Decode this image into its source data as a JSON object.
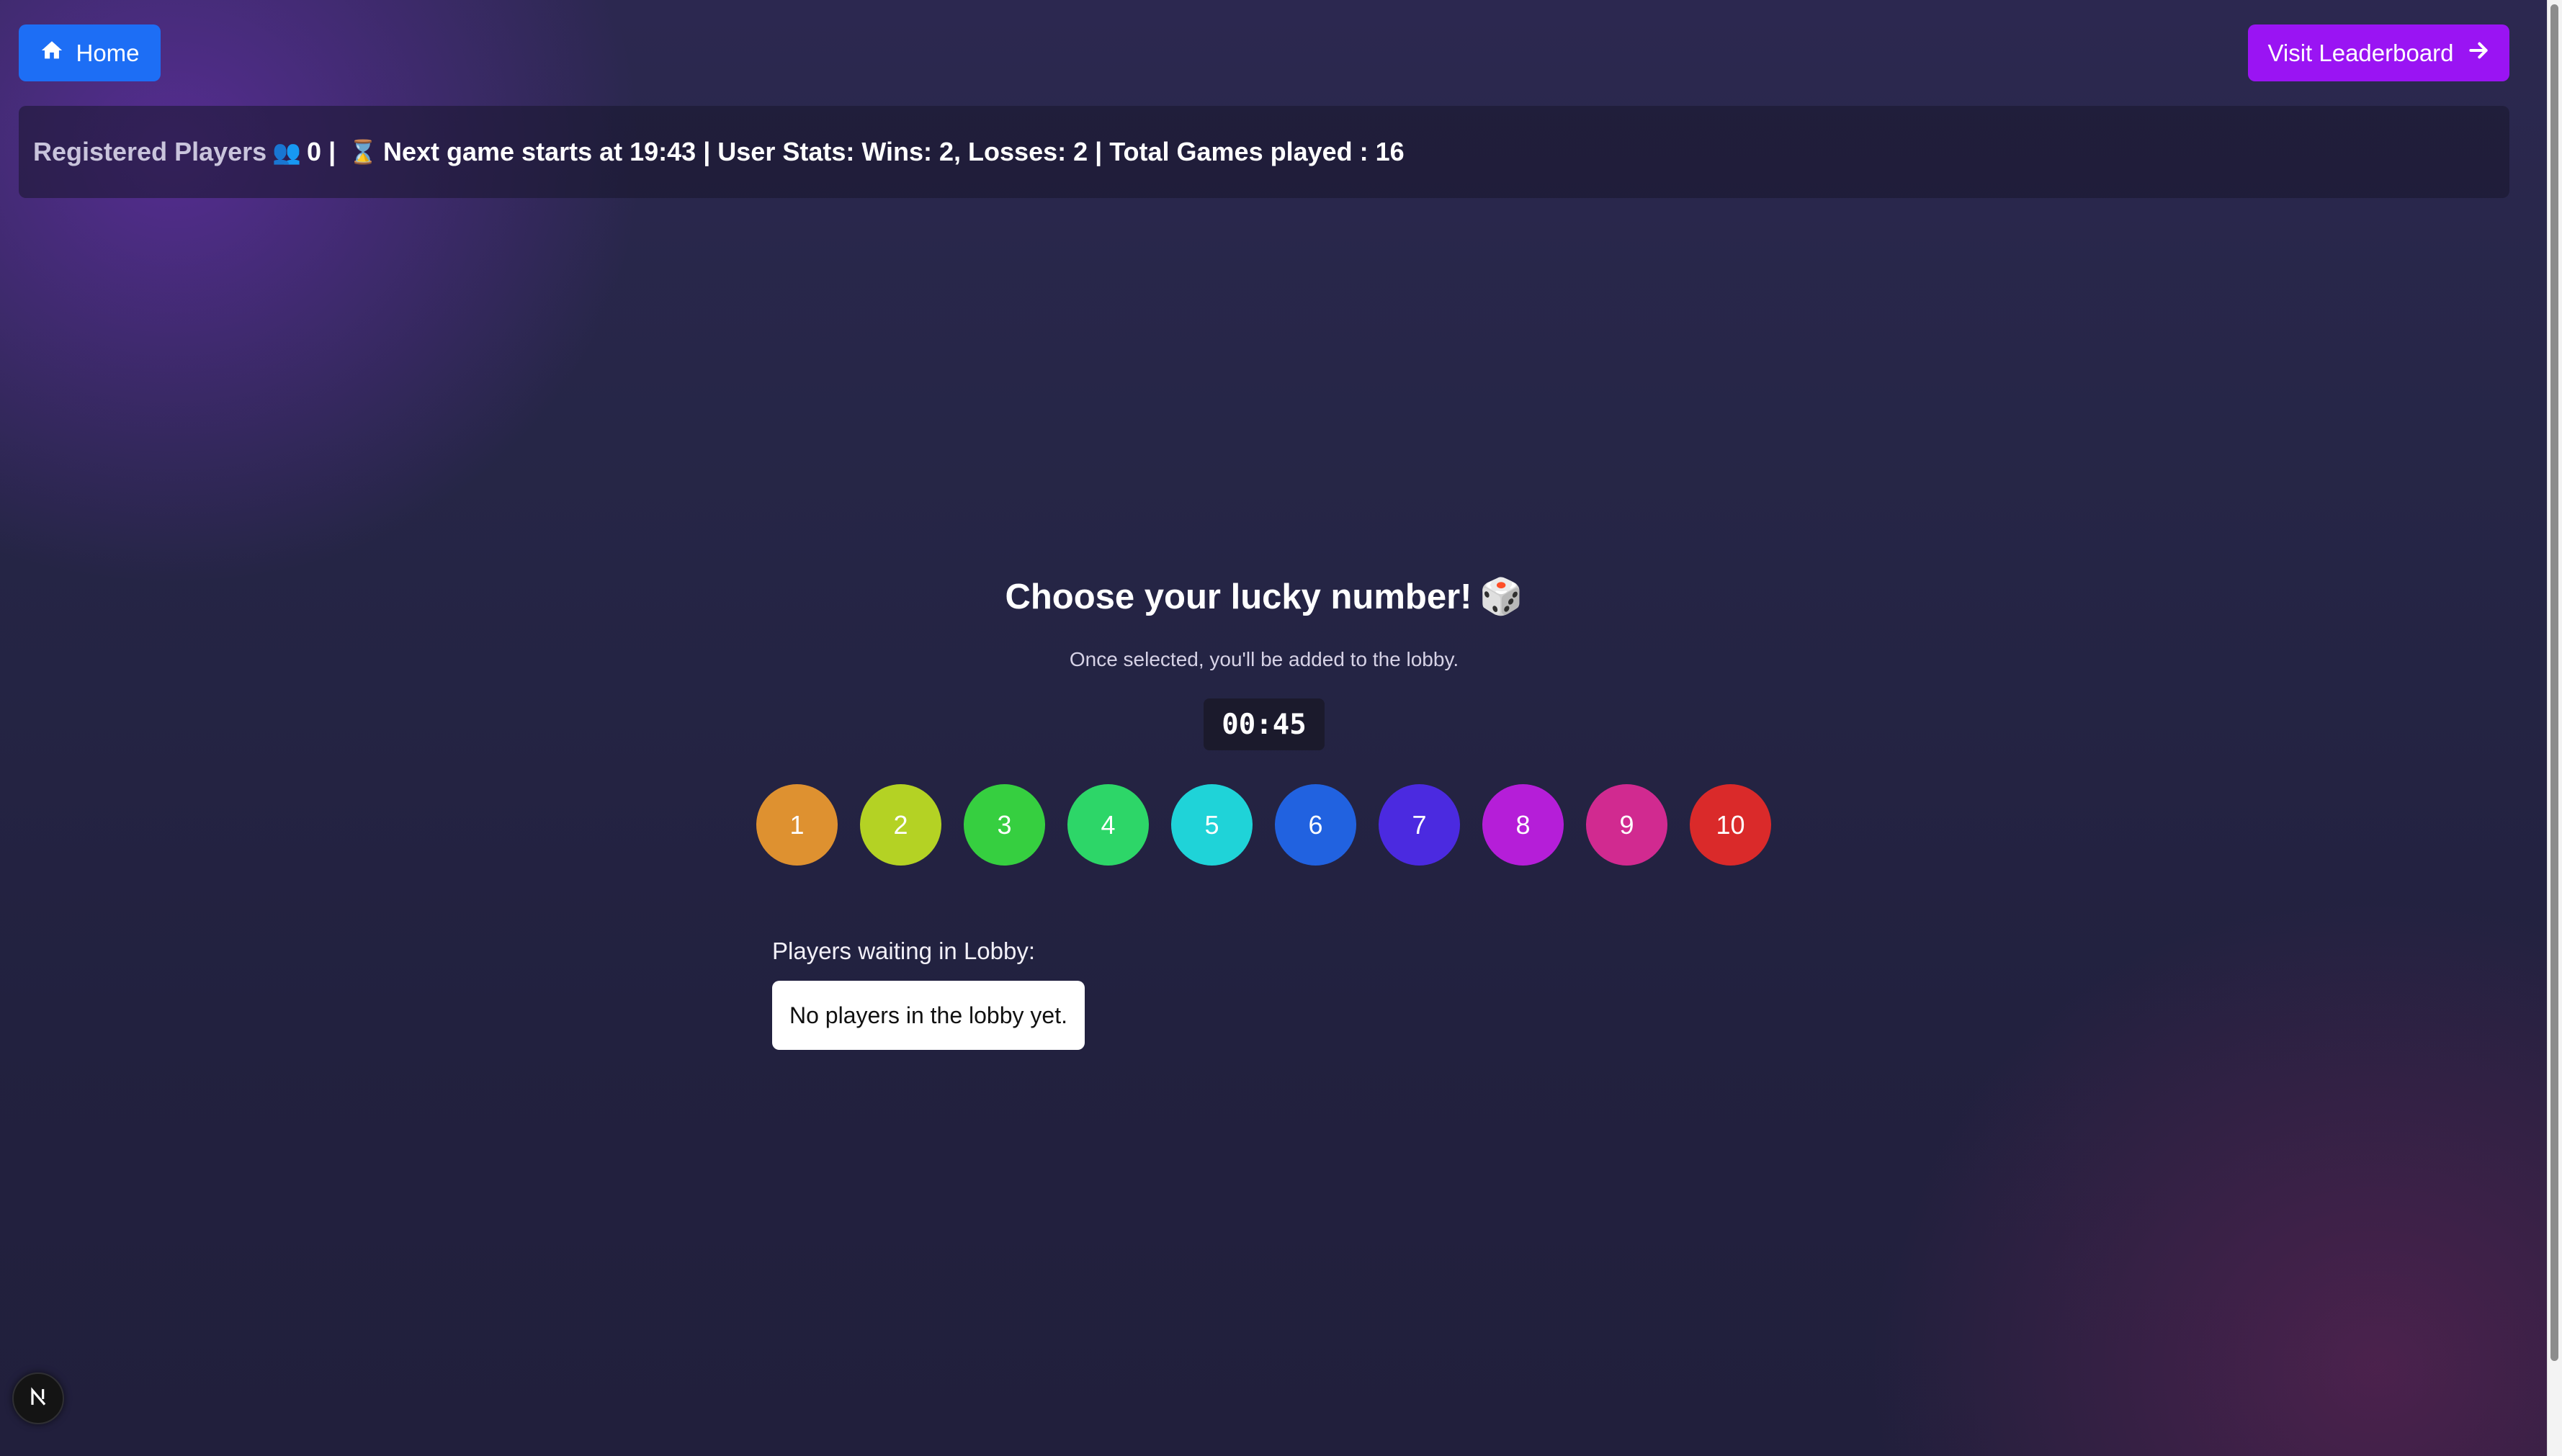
{
  "header": {
    "home_label": "Home",
    "leaderboard_label": "Visit Leaderboard",
    "home_icon": "house-icon",
    "leaderboard_icon": "arrow-right-icon"
  },
  "info_bar": {
    "registered_label": "Registered Players",
    "players_icon": "busts-icon",
    "registered_count": "0",
    "hourglass_icon": "hourglass-icon",
    "next_game_text": "Next game starts at 19:43",
    "user_stats_text": "User Stats: Wins: 2, Losses: 2",
    "total_games_text": "Total Games played : 16"
  },
  "main": {
    "title": "Choose your lucky number!",
    "dice_icon": "dice-icon",
    "subtitle": "Once selected, you'll be added to the lobby.",
    "timer": "00:45",
    "numbers": [
      {
        "label": "1",
        "color": "#de9130"
      },
      {
        "label": "2",
        "color": "#b4d224"
      },
      {
        "label": "3",
        "color": "#36cf40"
      },
      {
        "label": "4",
        "color": "#2dd668"
      },
      {
        "label": "5",
        "color": "#1fd3d8"
      },
      {
        "label": "6",
        "color": "#2162e0"
      },
      {
        "label": "7",
        "color": "#4b2ae0"
      },
      {
        "label": "8",
        "color": "#b51ed8"
      },
      {
        "label": "9",
        "color": "#d12a90"
      },
      {
        "label": "10",
        "color": "#da2a2a"
      }
    ]
  },
  "lobby": {
    "label": "Players waiting in Lobby:",
    "empty_text": "No players in the lobby yet."
  },
  "dev_badge": {
    "icon": "nextjs-icon"
  }
}
